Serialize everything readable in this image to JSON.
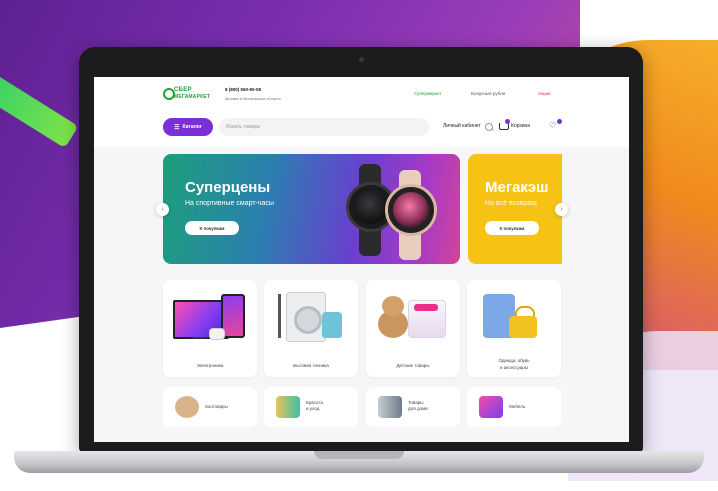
{
  "site": {
    "logo_line1": "СБЕР",
    "logo_line2": "МЕГАМАРКЕТ",
    "phone": "8 (800) 550-90-08",
    "region": "Москва и Московская область",
    "top_links": [
      {
        "label": "Супермаркет",
        "color": "#21a038"
      },
      {
        "label": "Бонусные рубли",
        "color": "#555555"
      },
      {
        "label": "Акции",
        "color": "#e0322c"
      }
    ],
    "catalog_label": "Каталог",
    "search_placeholder": "Искать товары",
    "account_label": "Личный кабинет",
    "cart_label": "Корзина"
  },
  "banners": [
    {
      "title": "Суперцены",
      "subtitle": "На спортивные смарт-часы",
      "button": "К покупкам",
      "colors": [
        "#1d9f7a",
        "#6a3fd0",
        "#d2449a"
      ]
    },
    {
      "title": "Мегакэш",
      "subtitle": "На всё возвращ",
      "button": "К покупкам",
      "color": "#f6c315"
    }
  ],
  "categories": [
    {
      "label": "Электроника"
    },
    {
      "label": "Бытовая техника"
    },
    {
      "label": "Детские товары"
    },
    {
      "label_line1": "Одежда, обувь",
      "label_line2": "и аксессуары"
    }
  ],
  "categories_small": [
    {
      "label": "Зоотовары"
    },
    {
      "label_line1": "Красота",
      "label_line2": "и уход"
    },
    {
      "label_line1": "Товары",
      "label_line2": "для дома"
    },
    {
      "label": "Мебель"
    }
  ],
  "theme": {
    "accent": "#7b2fd6",
    "brand_green": "#21a038"
  }
}
